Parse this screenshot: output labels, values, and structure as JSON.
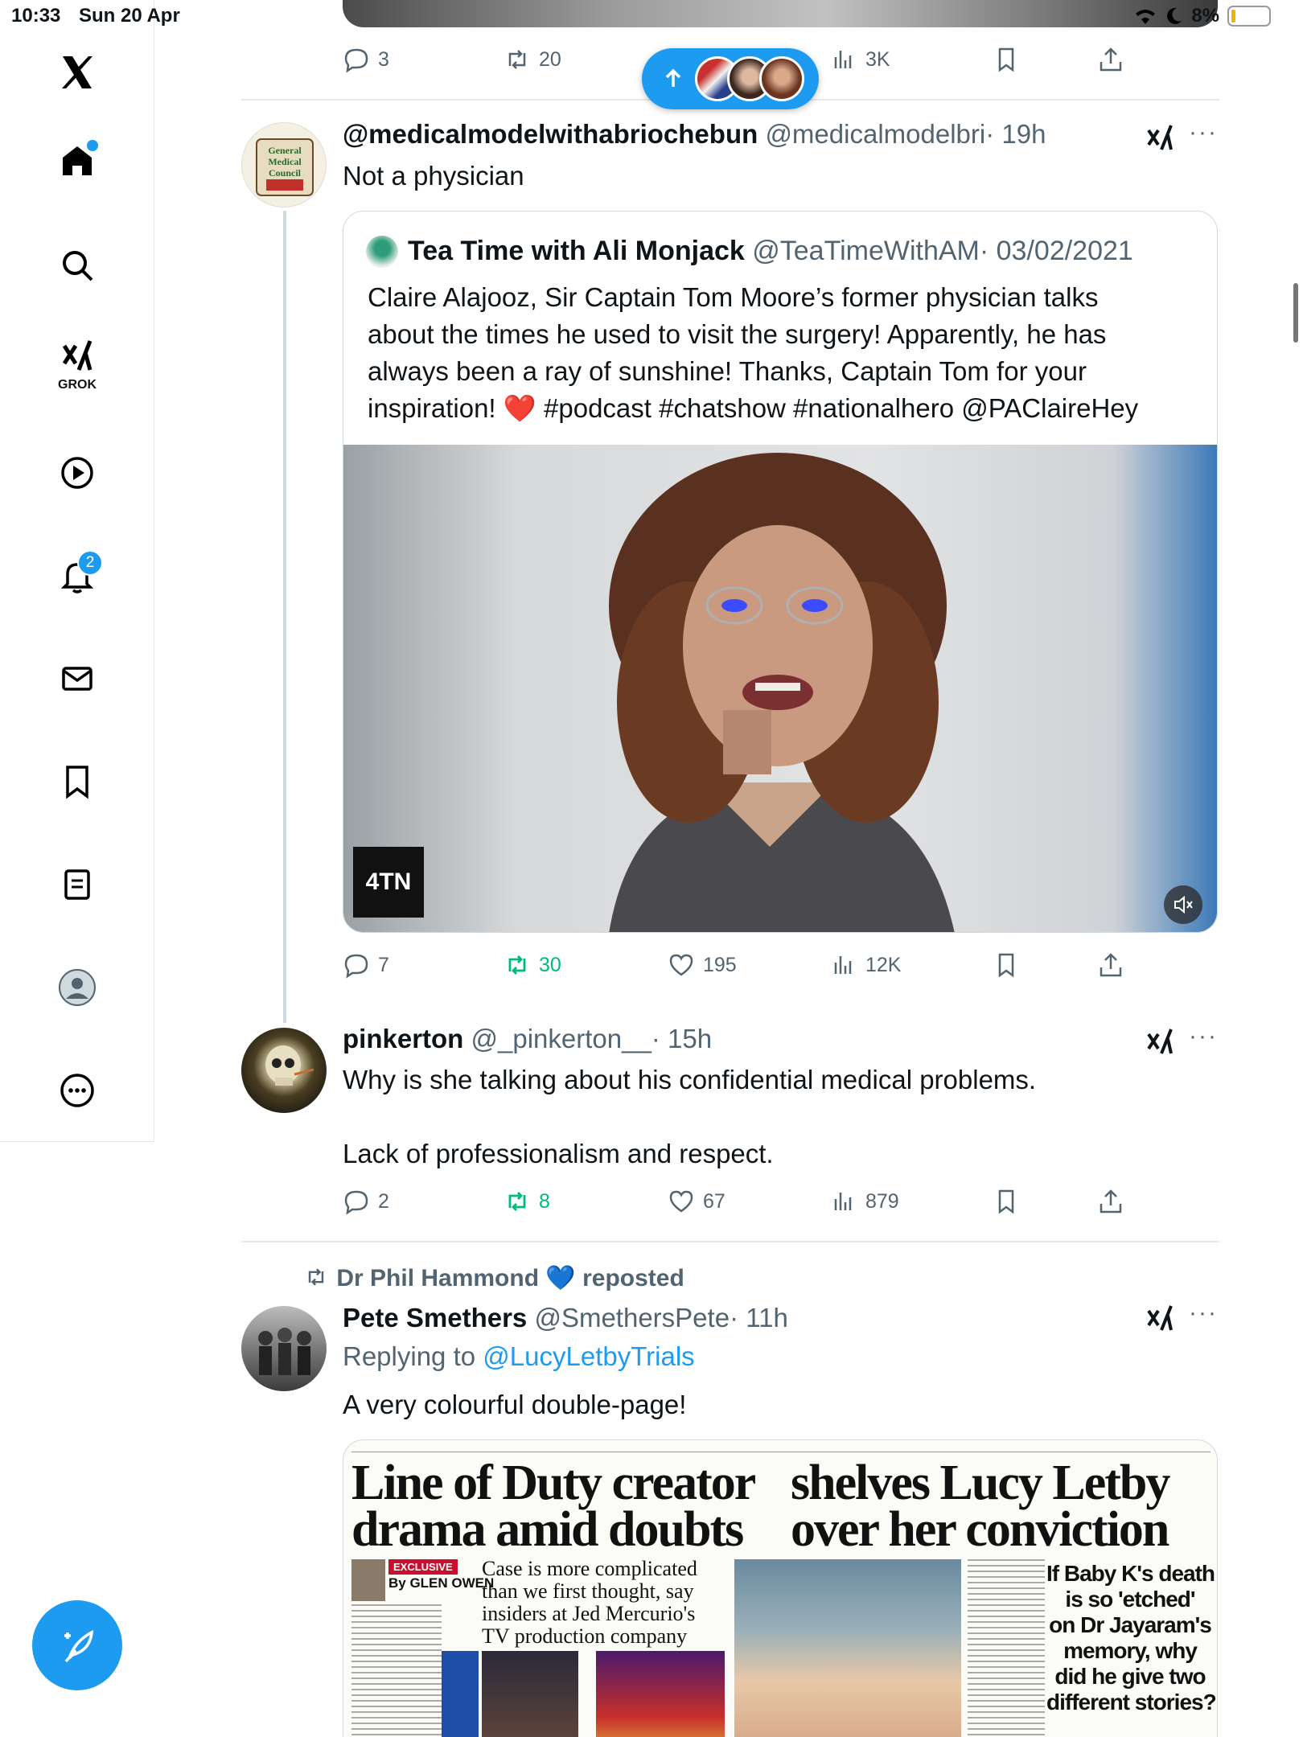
{
  "status_bar": {
    "time": "10:33",
    "date": "Sun 20 Apr",
    "battery": "8%"
  },
  "sidebar": {
    "grok_label": "GROK",
    "notification_count": "2"
  },
  "top_tweet_actions": {
    "replies": "3",
    "reposts": "20",
    "views": "3K"
  },
  "tweets": [
    {
      "name": "@medicalmodelwithabriochebun",
      "handle": "@medicalmodelbri",
      "time": "· 19h",
      "text": "Not a physician",
      "avatar_text": "General Medical Council",
      "quote": {
        "name": "Tea Time with Ali Monjack",
        "handle": "@TeaTimeWithAM",
        "date": "· 03/02/2021",
        "lines": [
          "Claire Alajooz,  Sir Captain Tom Moore’s former physician talks",
          "about the times he used to visit the surgery! Apparently, he has",
          "always been a ray of sunshine! Thanks, Captain Tom for your",
          "inspiration! ❤️ #podcast #chatshow #nationalhero @PAClaireHey"
        ],
        "video_logo": "4TN"
      },
      "actions": {
        "replies": "7",
        "reposts": "30",
        "likes": "195",
        "views": "12K"
      }
    },
    {
      "name": "pinkerton",
      "handle": "@_pinkerton__",
      "time": "· 15h",
      "line1": "Why is she talking about his confidential medical problems.",
      "line2": "Lack of professionalism and respect.",
      "actions": {
        "replies": "2",
        "reposts": "8",
        "likes": "67",
        "views": "879"
      }
    },
    {
      "reposted_by": "Dr Phil Hammond",
      "reposted_heart": "💙",
      "reposted_label": "reposted",
      "name": "Pete Smethers",
      "handle": "@SmethersPete",
      "time": "· 11h",
      "replying_label": "Replying to",
      "replying_to": "@LucyLetbyTrials",
      "text": "A very colourful double-page!",
      "news": {
        "headline_left_1": "Line of Duty creator",
        "headline_left_2": "drama amid doubts",
        "headline_right_1": "shelves Lucy Letby",
        "headline_right_2": "over her conviction",
        "exclusive": "EXCLUSIVE",
        "byline": "By GLEN OWEN",
        "sub": [
          "Case is more complicated",
          "than we first thought, say",
          "insiders at Jed Mercurio's",
          "TV production company"
        ],
        "side": [
          "If Baby K's death",
          "is so 'etched'",
          "on Dr Jayaram's",
          "memory, why",
          "did he give two",
          "different stories?"
        ]
      }
    }
  ]
}
